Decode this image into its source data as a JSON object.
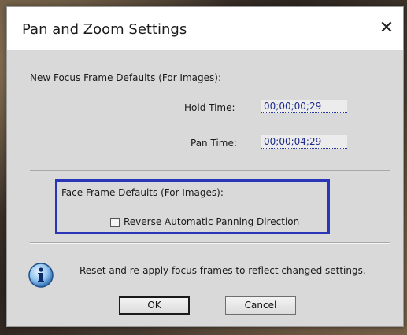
{
  "dialog": {
    "title": "Pan and Zoom Settings",
    "close_glyph": "✕"
  },
  "focus_frame": {
    "heading": "New Focus Frame Defaults (For Images):",
    "hold_time_label": "Hold Time:",
    "hold_time_value": "00;00;00;29",
    "pan_time_label": "Pan Time:",
    "pan_time_value": "00;00;04;29"
  },
  "face_frame": {
    "heading": "Face Frame Defaults (For Images):",
    "reverse_label": "Reverse Automatic Panning Direction",
    "reverse_checked": false
  },
  "info": {
    "icon": "info-icon",
    "message": "Reset and re-apply focus frames to reflect changed settings."
  },
  "buttons": {
    "ok_label": "OK",
    "cancel_label": "Cancel"
  },
  "colors": {
    "highlight_border": "#2a36b8",
    "value_text": "#1c2a8a"
  }
}
